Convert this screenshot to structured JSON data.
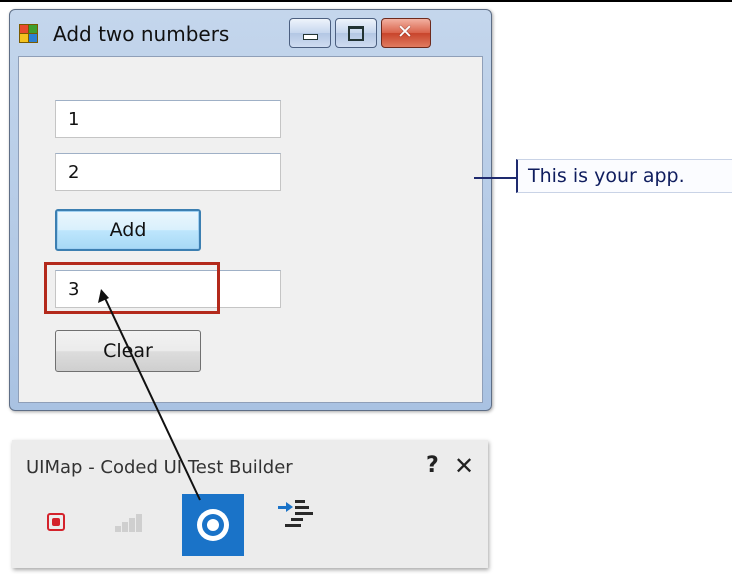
{
  "window": {
    "title": "Add two numbers",
    "first_value": "1",
    "second_value": "2",
    "add_label": "Add",
    "result_value": "3",
    "clear_label": "Clear"
  },
  "callout": {
    "text": "This is your app."
  },
  "builder": {
    "title": "UIMap - Coded UI Test Builder",
    "help": "?",
    "close": "✕"
  },
  "colors": {
    "highlight": "#b3291b",
    "crosshair_active": "#1a73c8",
    "record": "#d4222b",
    "callout": "#1e2a6e"
  },
  "icons": [
    "app-window-icon",
    "minimize-icon",
    "maximize-icon",
    "close-icon",
    "record-icon",
    "recorded-steps-icon",
    "crosshair-icon",
    "generate-code-icon"
  ]
}
